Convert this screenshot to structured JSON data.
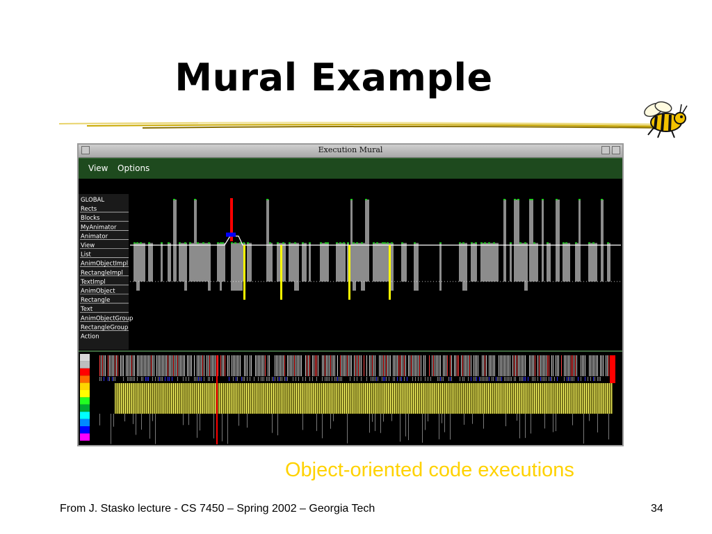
{
  "slide": {
    "title": "Mural Example",
    "caption": "Object-oriented code executions",
    "footer_left": "From J. Stasko lecture - CS 7450 – Spring 2002 – Georgia Tech",
    "page_number": "34"
  },
  "window": {
    "title": "Execution Mural",
    "menu": [
      {
        "label": "View"
      },
      {
        "label": "Options"
      }
    ]
  },
  "mural": {
    "classes": [
      "GLOBAL",
      "Rects",
      "Blocks",
      "MyAnimator",
      "Animator",
      "View",
      "List",
      "AnimObjectImpl",
      "RectangleImpl",
      "TextImpl",
      "AnimObject",
      "Rectangle",
      "Text",
      "AnimObjectGroup",
      "RectangleGroup",
      "Action"
    ],
    "palette": [
      "#d8d8d8",
      "#bdbdbd",
      "#ff0000",
      "#ff6a00",
      "#ffd400",
      "#ffff00",
      "#22ff22",
      "#00aa33",
      "#00ffff",
      "#0088ff",
      "#0000ff",
      "#ff00ff"
    ]
  },
  "colors": {
    "caption": "#ffd200",
    "menubar": "#1e4a1e",
    "trace_gray": "#8c8c8c",
    "trace_yellow": "#ffff00",
    "trace_red": "#ff0000",
    "trace_blue": "#0000ff",
    "trace_green": "#22cc22"
  }
}
